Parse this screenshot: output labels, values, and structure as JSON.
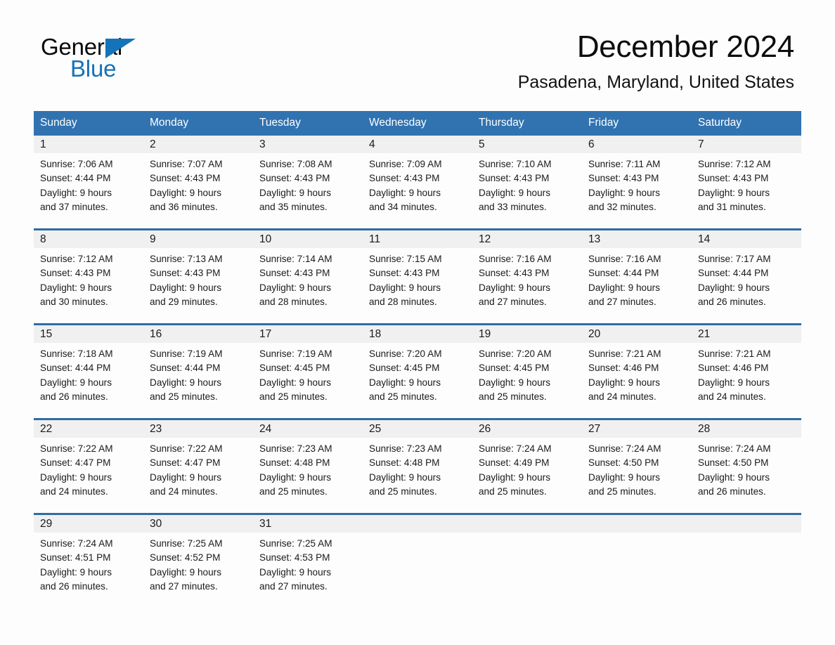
{
  "brand": {
    "name_part1": "General",
    "name_part2": "Blue",
    "triangle_color": "#1573b9",
    "blue_text_color": "#1672b8"
  },
  "header": {
    "month_title": "December 2024",
    "location": "Pasadena, Maryland, United States"
  },
  "theme": {
    "header_blue": "#3173b0",
    "row_divider_blue": "#2e6da4",
    "daynum_band_gray": "#f0f0f0",
    "page_background": "#fdfdfd",
    "text_color": "#1a1a1a"
  },
  "calendar": {
    "weekday_headers": [
      "Sunday",
      "Monday",
      "Tuesday",
      "Wednesday",
      "Thursday",
      "Friday",
      "Saturday"
    ],
    "weeks": [
      [
        {
          "day": "1",
          "sunrise": "Sunrise: 7:06 AM",
          "sunset": "Sunset: 4:44 PM",
          "daylight_line1": "Daylight: 9 hours",
          "daylight_line2": "and 37 minutes."
        },
        {
          "day": "2",
          "sunrise": "Sunrise: 7:07 AM",
          "sunset": "Sunset: 4:43 PM",
          "daylight_line1": "Daylight: 9 hours",
          "daylight_line2": "and 36 minutes."
        },
        {
          "day": "3",
          "sunrise": "Sunrise: 7:08 AM",
          "sunset": "Sunset: 4:43 PM",
          "daylight_line1": "Daylight: 9 hours",
          "daylight_line2": "and 35 minutes."
        },
        {
          "day": "4",
          "sunrise": "Sunrise: 7:09 AM",
          "sunset": "Sunset: 4:43 PM",
          "daylight_line1": "Daylight: 9 hours",
          "daylight_line2": "and 34 minutes."
        },
        {
          "day": "5",
          "sunrise": "Sunrise: 7:10 AM",
          "sunset": "Sunset: 4:43 PM",
          "daylight_line1": "Daylight: 9 hours",
          "daylight_line2": "and 33 minutes."
        },
        {
          "day": "6",
          "sunrise": "Sunrise: 7:11 AM",
          "sunset": "Sunset: 4:43 PM",
          "daylight_line1": "Daylight: 9 hours",
          "daylight_line2": "and 32 minutes."
        },
        {
          "day": "7",
          "sunrise": "Sunrise: 7:12 AM",
          "sunset": "Sunset: 4:43 PM",
          "daylight_line1": "Daylight: 9 hours",
          "daylight_line2": "and 31 minutes."
        }
      ],
      [
        {
          "day": "8",
          "sunrise": "Sunrise: 7:12 AM",
          "sunset": "Sunset: 4:43 PM",
          "daylight_line1": "Daylight: 9 hours",
          "daylight_line2": "and 30 minutes."
        },
        {
          "day": "9",
          "sunrise": "Sunrise: 7:13 AM",
          "sunset": "Sunset: 4:43 PM",
          "daylight_line1": "Daylight: 9 hours",
          "daylight_line2": "and 29 minutes."
        },
        {
          "day": "10",
          "sunrise": "Sunrise: 7:14 AM",
          "sunset": "Sunset: 4:43 PM",
          "daylight_line1": "Daylight: 9 hours",
          "daylight_line2": "and 28 minutes."
        },
        {
          "day": "11",
          "sunrise": "Sunrise: 7:15 AM",
          "sunset": "Sunset: 4:43 PM",
          "daylight_line1": "Daylight: 9 hours",
          "daylight_line2": "and 28 minutes."
        },
        {
          "day": "12",
          "sunrise": "Sunrise: 7:16 AM",
          "sunset": "Sunset: 4:43 PM",
          "daylight_line1": "Daylight: 9 hours",
          "daylight_line2": "and 27 minutes."
        },
        {
          "day": "13",
          "sunrise": "Sunrise: 7:16 AM",
          "sunset": "Sunset: 4:44 PM",
          "daylight_line1": "Daylight: 9 hours",
          "daylight_line2": "and 27 minutes."
        },
        {
          "day": "14",
          "sunrise": "Sunrise: 7:17 AM",
          "sunset": "Sunset: 4:44 PM",
          "daylight_line1": "Daylight: 9 hours",
          "daylight_line2": "and 26 minutes."
        }
      ],
      [
        {
          "day": "15",
          "sunrise": "Sunrise: 7:18 AM",
          "sunset": "Sunset: 4:44 PM",
          "daylight_line1": "Daylight: 9 hours",
          "daylight_line2": "and 26 minutes."
        },
        {
          "day": "16",
          "sunrise": "Sunrise: 7:19 AM",
          "sunset": "Sunset: 4:44 PM",
          "daylight_line1": "Daylight: 9 hours",
          "daylight_line2": "and 25 minutes."
        },
        {
          "day": "17",
          "sunrise": "Sunrise: 7:19 AM",
          "sunset": "Sunset: 4:45 PM",
          "daylight_line1": "Daylight: 9 hours",
          "daylight_line2": "and 25 minutes."
        },
        {
          "day": "18",
          "sunrise": "Sunrise: 7:20 AM",
          "sunset": "Sunset: 4:45 PM",
          "daylight_line1": "Daylight: 9 hours",
          "daylight_line2": "and 25 minutes."
        },
        {
          "day": "19",
          "sunrise": "Sunrise: 7:20 AM",
          "sunset": "Sunset: 4:45 PM",
          "daylight_line1": "Daylight: 9 hours",
          "daylight_line2": "and 25 minutes."
        },
        {
          "day": "20",
          "sunrise": "Sunrise: 7:21 AM",
          "sunset": "Sunset: 4:46 PM",
          "daylight_line1": "Daylight: 9 hours",
          "daylight_line2": "and 24 minutes."
        },
        {
          "day": "21",
          "sunrise": "Sunrise: 7:21 AM",
          "sunset": "Sunset: 4:46 PM",
          "daylight_line1": "Daylight: 9 hours",
          "daylight_line2": "and 24 minutes."
        }
      ],
      [
        {
          "day": "22",
          "sunrise": "Sunrise: 7:22 AM",
          "sunset": "Sunset: 4:47 PM",
          "daylight_line1": "Daylight: 9 hours",
          "daylight_line2": "and 24 minutes."
        },
        {
          "day": "23",
          "sunrise": "Sunrise: 7:22 AM",
          "sunset": "Sunset: 4:47 PM",
          "daylight_line1": "Daylight: 9 hours",
          "daylight_line2": "and 24 minutes."
        },
        {
          "day": "24",
          "sunrise": "Sunrise: 7:23 AM",
          "sunset": "Sunset: 4:48 PM",
          "daylight_line1": "Daylight: 9 hours",
          "daylight_line2": "and 25 minutes."
        },
        {
          "day": "25",
          "sunrise": "Sunrise: 7:23 AM",
          "sunset": "Sunset: 4:48 PM",
          "daylight_line1": "Daylight: 9 hours",
          "daylight_line2": "and 25 minutes."
        },
        {
          "day": "26",
          "sunrise": "Sunrise: 7:24 AM",
          "sunset": "Sunset: 4:49 PM",
          "daylight_line1": "Daylight: 9 hours",
          "daylight_line2": "and 25 minutes."
        },
        {
          "day": "27",
          "sunrise": "Sunrise: 7:24 AM",
          "sunset": "Sunset: 4:50 PM",
          "daylight_line1": "Daylight: 9 hours",
          "daylight_line2": "and 25 minutes."
        },
        {
          "day": "28",
          "sunrise": "Sunrise: 7:24 AM",
          "sunset": "Sunset: 4:50 PM",
          "daylight_line1": "Daylight: 9 hours",
          "daylight_line2": "and 26 minutes."
        }
      ],
      [
        {
          "day": "29",
          "sunrise": "Sunrise: 7:24 AM",
          "sunset": "Sunset: 4:51 PM",
          "daylight_line1": "Daylight: 9 hours",
          "daylight_line2": "and 26 minutes."
        },
        {
          "day": "30",
          "sunrise": "Sunrise: 7:25 AM",
          "sunset": "Sunset: 4:52 PM",
          "daylight_line1": "Daylight: 9 hours",
          "daylight_line2": "and 27 minutes."
        },
        {
          "day": "31",
          "sunrise": "Sunrise: 7:25 AM",
          "sunset": "Sunset: 4:53 PM",
          "daylight_line1": "Daylight: 9 hours",
          "daylight_line2": "and 27 minutes."
        },
        {
          "day": "",
          "sunrise": "",
          "sunset": "",
          "daylight_line1": "",
          "daylight_line2": ""
        },
        {
          "day": "",
          "sunrise": "",
          "sunset": "",
          "daylight_line1": "",
          "daylight_line2": ""
        },
        {
          "day": "",
          "sunrise": "",
          "sunset": "",
          "daylight_line1": "",
          "daylight_line2": ""
        },
        {
          "day": "",
          "sunrise": "",
          "sunset": "",
          "daylight_line1": "",
          "daylight_line2": ""
        }
      ]
    ]
  }
}
